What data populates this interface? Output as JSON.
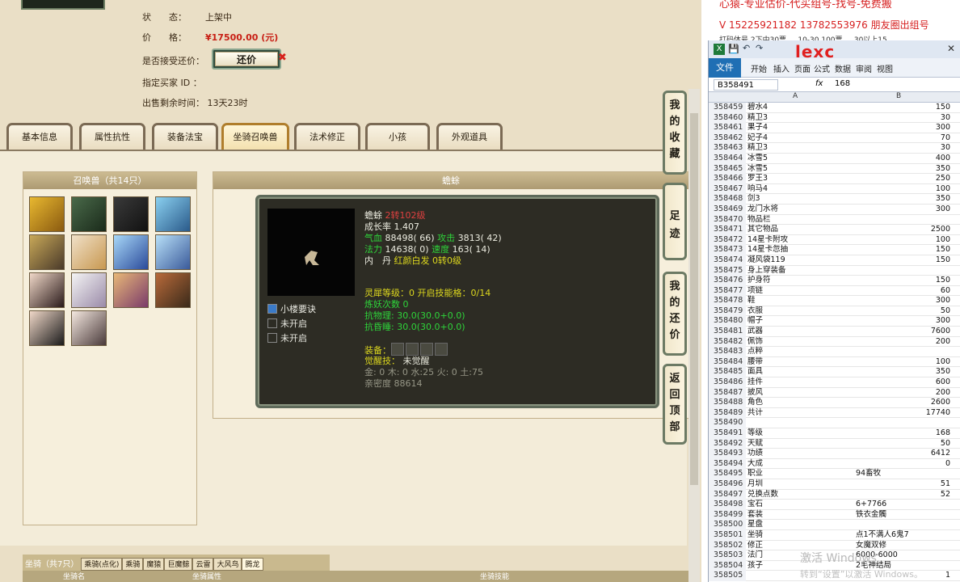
{
  "info": {
    "status_label": "状　　态：",
    "status_value": "上架中",
    "price_label": "价　　格：",
    "price_value": "¥17500.00 (元)",
    "counter_label": "是否接受还价：",
    "counter_button": "还价",
    "buyer_label": "指定买家 ID ：",
    "time_label": "出售剩余时间：",
    "time_value": "13天23时"
  },
  "tabs": [
    "基本信息",
    "属性抗性",
    "装备法宝",
    "坐骑召唤兽",
    "法术修正",
    "小孩",
    "外观道具"
  ],
  "active_tab": "坐骑召唤兽",
  "pets_title": "召唤兽（共14只）",
  "detail_title": "蟾蜍",
  "pet_detail": {
    "name": "蟾蜍",
    "level": "2转102级",
    "growth": "成长率 1.407",
    "hp_label": "气血",
    "hp": "88498",
    "hp_extra": "( 66)",
    "atk_label": "攻击",
    "atk": "3813",
    "atk_extra": "( 42)",
    "mp_label": "法力",
    "mp": "14638",
    "mp_extra": "( 0)",
    "spd_label": "速度",
    "spd": "163",
    "spd_extra": "( 14)",
    "neidan_label": "内　丹",
    "neidan_value": "红颜白发 0转0级",
    "lingxi": "灵犀等级：0 开启技能格：0/14",
    "lianyao": "炼妖次数 0",
    "wuli": "抗物理: 30.0(30.0+0.0)",
    "fengyin": "抗昏睡: 30.0(30.0+0.0)",
    "equip_label": "装备：",
    "juexing_label": "觉醒技：",
    "juexing_value": "未觉醒",
    "elements": "金: 0 木: 0 水:25 火: 0 土:75",
    "intimacy": "亲密度 88614",
    "skills": [
      "小楼要诀",
      "未开启",
      "未开启"
    ]
  },
  "side_buttons": [
    "我的收藏",
    "足迹",
    "我的还价",
    "返回顶部"
  ],
  "mounts_bar": {
    "label": "坐骑（共7只）",
    "tabs": [
      "乘骑(点化)",
      "乘骑",
      "魔猿",
      "巨魔鲸",
      "云雷",
      "大风鸟",
      "腾龙"
    ],
    "header_left": "坐骑名",
    "header_mid": "坐骑属性",
    "header_right": "坐骑技能"
  },
  "promo": {
    "line1": "心猿-专业估价-代买组号-找号-免费搬",
    "line2": "V 15225921182  13782553976 朋友圈出组号",
    "line3": "打码体号 2下中30票 ... 10-30 100票 ... 30以上15"
  },
  "excel": {
    "file_tab": "文件",
    "ribbon_tabs": [
      "开始",
      "插入",
      "页面",
      "公式",
      "数据",
      "审阅",
      "视图"
    ],
    "cell_ref": "B358491",
    "fx": "fx",
    "formula_value": "168",
    "col_a": "A",
    "col_b": "B",
    "rows": [
      {
        "n": "358459",
        "a": "碧水4",
        "b": "150"
      },
      {
        "n": "358460",
        "a": "精卫3",
        "b": "30"
      },
      {
        "n": "358461",
        "a": "果子4",
        "b": "300"
      },
      {
        "n": "358462",
        "a": "妃子4",
        "b": "70"
      },
      {
        "n": "358463",
        "a": "精卫3",
        "b": "30"
      },
      {
        "n": "358464",
        "a": "冰雪5",
        "b": "400"
      },
      {
        "n": "358465",
        "a": "冰雪5",
        "b": "350"
      },
      {
        "n": "358466",
        "a": "罗王3",
        "b": "250"
      },
      {
        "n": "358467",
        "a": "响马4",
        "b": "100"
      },
      {
        "n": "358468",
        "a": "剑3",
        "b": "350"
      },
      {
        "n": "358469",
        "a": "龙门水将",
        "b": "300"
      },
      {
        "n": "358470",
        "a": "物品栏",
        "b": ""
      },
      {
        "n": "358471",
        "a": "其它物品",
        "b": "2500"
      },
      {
        "n": "358472",
        "a": "14星卡附攻",
        "b": "100"
      },
      {
        "n": "358473",
        "a": "14星卡忽抽",
        "b": "150"
      },
      {
        "n": "358474",
        "a": "凝风袋119",
        "b": "150"
      },
      {
        "n": "358475",
        "a": "身上穿装备",
        "b": ""
      },
      {
        "n": "358476",
        "a": "护身符",
        "b": "150"
      },
      {
        "n": "358477",
        "a": "项链",
        "b": "60"
      },
      {
        "n": "358478",
        "a": "鞋",
        "b": "300"
      },
      {
        "n": "358479",
        "a": "衣服",
        "b": "50"
      },
      {
        "n": "358480",
        "a": "帽子",
        "b": "300"
      },
      {
        "n": "358481",
        "a": "武器",
        "b": "7600"
      },
      {
        "n": "358482",
        "a": "佩饰",
        "b": "200"
      },
      {
        "n": "358483",
        "a": "点粹",
        "b": ""
      },
      {
        "n": "358484",
        "a": "腰带",
        "b": "100"
      },
      {
        "n": "358485",
        "a": "面具",
        "b": "350"
      },
      {
        "n": "358486",
        "a": "挂件",
        "b": "600"
      },
      {
        "n": "358487",
        "a": "披风",
        "b": "200"
      },
      {
        "n": "358488",
        "a": "角色",
        "b": "2600"
      },
      {
        "n": "358489",
        "a": "共计",
        "b": "17740"
      },
      {
        "n": "358490",
        "a": "",
        "b": ""
      },
      {
        "n": "358491",
        "a": "等级",
        "b": "168"
      },
      {
        "n": "358492",
        "a": "天赋",
        "b": "50"
      },
      {
        "n": "358493",
        "a": "功绩",
        "b": "6412"
      },
      {
        "n": "358494",
        "a": "大成",
        "b": "0"
      },
      {
        "n": "358495",
        "a": "职业",
        "bl": "94畜牧"
      },
      {
        "n": "358496",
        "a": "月圳",
        "b": "51"
      },
      {
        "n": "358497",
        "a": "兑换点数",
        "b": "52"
      },
      {
        "n": "358498",
        "a": "宝石",
        "bl": "6+7766"
      },
      {
        "n": "358499",
        "a": "套装",
        "bl": "铁衣金髑"
      },
      {
        "n": "358500",
        "a": "星盘",
        "b": ""
      },
      {
        "n": "358501",
        "a": "坐骑",
        "bl": "点1不满人6鬼7"
      },
      {
        "n": "358502",
        "a": "修正",
        "bl": "女魔双修"
      },
      {
        "n": "358503",
        "a": "法门",
        "bl": "6000-6000"
      },
      {
        "n": "358504",
        "a": "孩子",
        "bl": "2毛神结局"
      },
      {
        "n": "358505",
        "a": "",
        "b": "1"
      }
    ]
  },
  "watermark": {
    "line1": "激活 Windows",
    "line2": "转到“设置”以激活 Windows。"
  },
  "overlay_logo": "lexc"
}
